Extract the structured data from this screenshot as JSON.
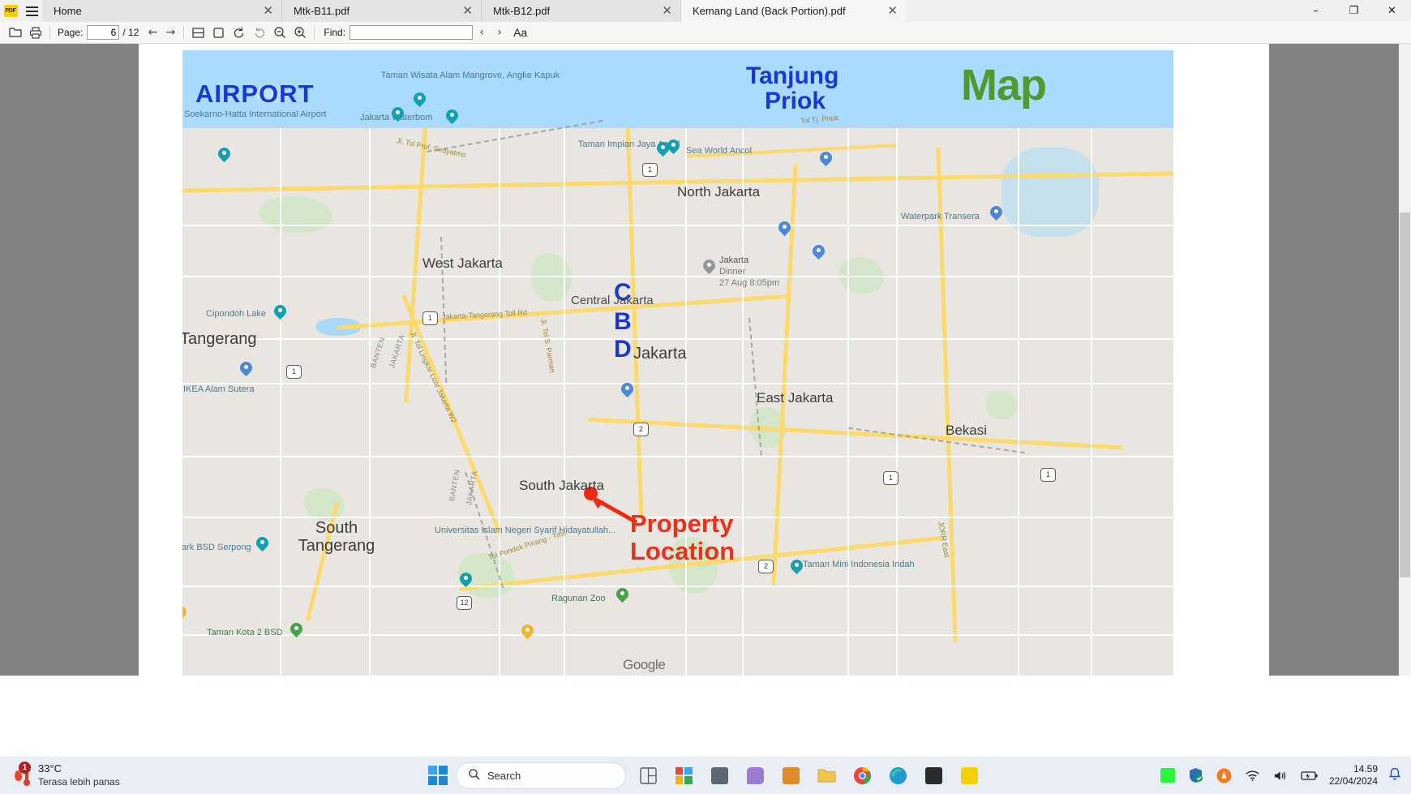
{
  "window": {
    "app_icon": "pdf-app-icon",
    "menu_icon": "hamburger-menu-icon",
    "minimize_label": "–",
    "maximize_label": "❐",
    "close_label": "✕",
    "tabs": [
      {
        "label": "Home",
        "close": "✕",
        "active": false
      },
      {
        "label": "Mtk-B11.pdf",
        "close": "✕",
        "active": false
      },
      {
        "label": "Mtk-B12.pdf",
        "close": "✕",
        "active": false
      },
      {
        "label": "Kemang Land (Back Portion).pdf",
        "close": "✕",
        "active": true
      }
    ]
  },
  "toolbar": {
    "open_icon": "open-folder-icon",
    "print_icon": "printer-icon",
    "page_label": "Page:",
    "page_value": "6",
    "page_total": "/ 12",
    "prev_page_icon": "←",
    "next_page_icon": "→",
    "fit_page_icon": "fit-page-icon",
    "fit_width_icon": "fit-width-icon",
    "rotate_ccw_icon": "rotate-counterclockwise-icon",
    "rotate_cw_icon": "rotate-clockwise-icon",
    "zoom_out_icon": "zoom-out-icon",
    "zoom_in_icon": "zoom-in-icon",
    "find_label": "Find:",
    "find_value": "",
    "find_placeholder": "",
    "find_prev_icon": "‹",
    "find_next_icon": "›",
    "text_size_label": "Aa"
  },
  "map": {
    "annotations": {
      "airport": "AIRPORT",
      "tanjung_priok_line1": "Tanjung",
      "tanjung_priok_line2": "Priok",
      "map_title": "Map",
      "cbd_c": "C",
      "cbd_b": "B",
      "cbd_d": "D",
      "property_line1": "Property",
      "property_line2": "Location",
      "marker": "property-location-dot",
      "arrow": "property-location-arrow"
    },
    "colors": {
      "annotation_blue": "#1a37d1",
      "annotation_green": "#4f9a2f",
      "annotation_red": "#e8321c",
      "water": "#aadaff",
      "land": "#e9e6e1",
      "highway": "#fbd96b"
    },
    "cities": [
      {
        "name": "North Jakarta"
      },
      {
        "name": "West Jakarta"
      },
      {
        "name": "Central Jakarta"
      },
      {
        "name": "East Jakarta"
      },
      {
        "name": "South Jakarta"
      },
      {
        "name": "Jakarta"
      },
      {
        "name": "Tangerang"
      },
      {
        "name": "South Tangerang"
      },
      {
        "name": "Bekasi"
      }
    ],
    "places": [
      {
        "name": "Taman Wisata Alam Mangrove, Angke Kapuk"
      },
      {
        "name": "Soekarno-Hatta International Airport"
      },
      {
        "name": "Jakarta Waterbom"
      },
      {
        "name": "Taman Impian Jaya Ancol"
      },
      {
        "name": "Sea World Ancol"
      },
      {
        "name": "Waterpark Transera"
      },
      {
        "name": "Cipondoh Lake"
      },
      {
        "name": "IKEA Alam Sutera"
      },
      {
        "name": "Universitas Islam Negeri Syarif Hidayatullah..."
      },
      {
        "name": "Ragunan Zoo"
      },
      {
        "name": "Taman Kota 2 BSD"
      },
      {
        "name": "ark BSD Serpong"
      },
      {
        "name": "Taman Mini Indonesia Indah"
      }
    ],
    "calendar_pin": {
      "title": "Jakarta",
      "subtitle": "Dinner",
      "time": "27 Aug 8:05pm"
    },
    "roads": [
      {
        "name": "Jl. Tol Prof. Sedyatmo"
      },
      {
        "name": "Tol Tj. Priok"
      },
      {
        "name": "Jakarta-Tangerang Toll Rd"
      },
      {
        "name": "Jl. Tol S. Parman"
      },
      {
        "name": "Jl. Tol Lingkar Luar Jakarta W2"
      },
      {
        "name": "Tol Pondok Pinang - Tmii"
      },
      {
        "name": "JORR East"
      }
    ],
    "boundary_labels": [
      "BANTEN",
      "JAKARTA"
    ],
    "route_shields": [
      "1",
      "1",
      "1",
      "1",
      "1",
      "2",
      "2",
      "12"
    ],
    "watermark": "Google"
  },
  "taskbar": {
    "weather_temp": "33°C",
    "weather_desc": "Terasa lebih panas",
    "weather_badge": "1",
    "start_icon": "windows-start-icon",
    "search_icon": "search-icon",
    "search_placeholder": "Search",
    "pinned": [
      {
        "name": "widgets-icon"
      },
      {
        "name": "microsoft-store-icon"
      },
      {
        "name": "task-view-icon"
      },
      {
        "name": "chat-icon"
      },
      {
        "name": "store-apps-icon"
      },
      {
        "name": "file-explorer-icon"
      },
      {
        "name": "google-chrome-icon"
      },
      {
        "name": "microsoft-edge-icon"
      },
      {
        "name": "snipping-tool-icon"
      },
      {
        "name": "pdf-reader-icon"
      }
    ],
    "tray": [
      {
        "name": "green-app-icon"
      },
      {
        "name": "windows-security-icon"
      },
      {
        "name": "avast-icon"
      },
      {
        "name": "wifi-icon"
      },
      {
        "name": "volume-icon"
      },
      {
        "name": "battery-icon"
      }
    ],
    "clock_time": "14.59",
    "clock_date": "22/04/2024",
    "notification_icon": "notification-bell-icon"
  }
}
